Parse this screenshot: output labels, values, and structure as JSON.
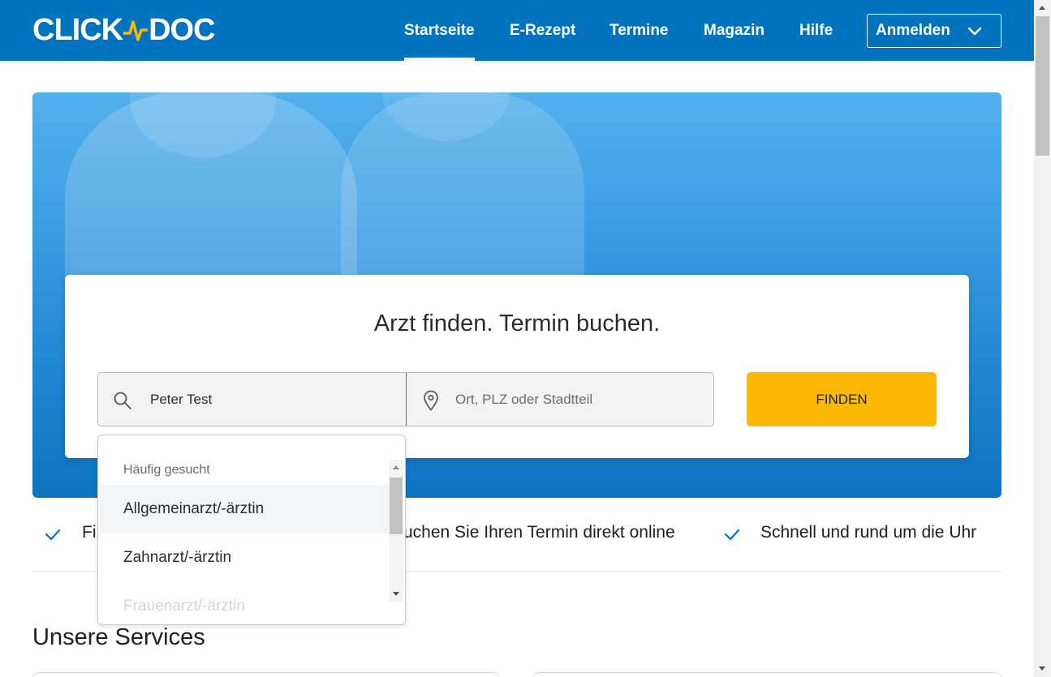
{
  "header": {
    "logo_left": "CLICK",
    "logo_right": "DOC",
    "nav": [
      {
        "label": "Startseite",
        "active": true
      },
      {
        "label": "E-Rezept",
        "active": false
      },
      {
        "label": "Termine",
        "active": false
      },
      {
        "label": "Magazin",
        "active": false
      },
      {
        "label": "Hilfe",
        "active": false
      }
    ],
    "login_label": "Anmelden"
  },
  "hero": {
    "title": "Arzt finden. Termin buchen.",
    "search_value": "Peter Test",
    "location_placeholder": "Ort, PLZ oder Stadtteil",
    "find_label": "FINDEN"
  },
  "dropdown": {
    "heading": "Häufig gesucht",
    "items": [
      "Allgemeinarzt/-ärztin",
      "Zahnarzt/-ärztin",
      "Frauenarzt/-ärztin"
    ]
  },
  "usps": [
    "Fi",
    "uchen Sie Ihren Termin direkt online",
    "Schnell und rund um die Uhr"
  ],
  "services": {
    "title": "Unsere Services"
  },
  "colors": {
    "brand_blue": "#0073bf",
    "accent_yellow": "#fbb800",
    "logo_pulse": "#fbb800"
  }
}
